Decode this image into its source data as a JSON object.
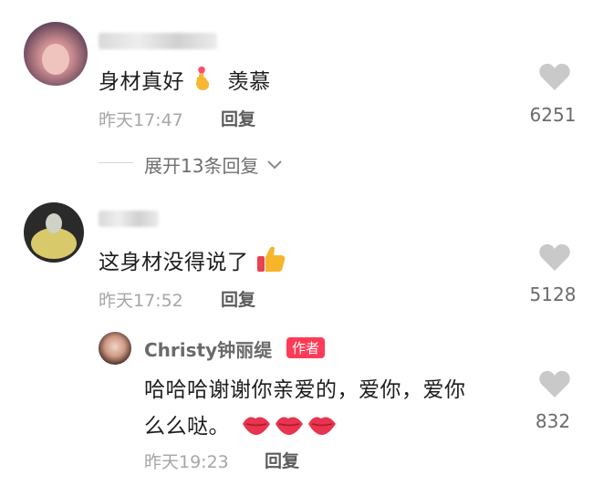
{
  "comments": [
    {
      "text": "身材真好",
      "text_emoji": "羡慕",
      "time": "昨天17:47",
      "reply": "回复",
      "likes": "6251"
    },
    {
      "text": "这身材没得说了",
      "time": "昨天17:52",
      "reply": "回复",
      "likes": "5128"
    }
  ],
  "expand_label": "展开13条回复",
  "author_reply": {
    "name": "Christy钟丽缇",
    "badge": "作者",
    "line1": "哈哈哈谢谢你亲爱的，爱你，爱你",
    "line2": "么么哒。",
    "time": "昨天19:23",
    "reply": "回复",
    "likes": "832"
  },
  "colors": {
    "badge": "#ff3b57",
    "heart": "#c9c9c9",
    "lips": "#e8344f"
  },
  "icons": [
    "finger-heart-icon",
    "thumbs-up-icon",
    "heart-icon",
    "chevron-down-icon",
    "lips-icon"
  ]
}
